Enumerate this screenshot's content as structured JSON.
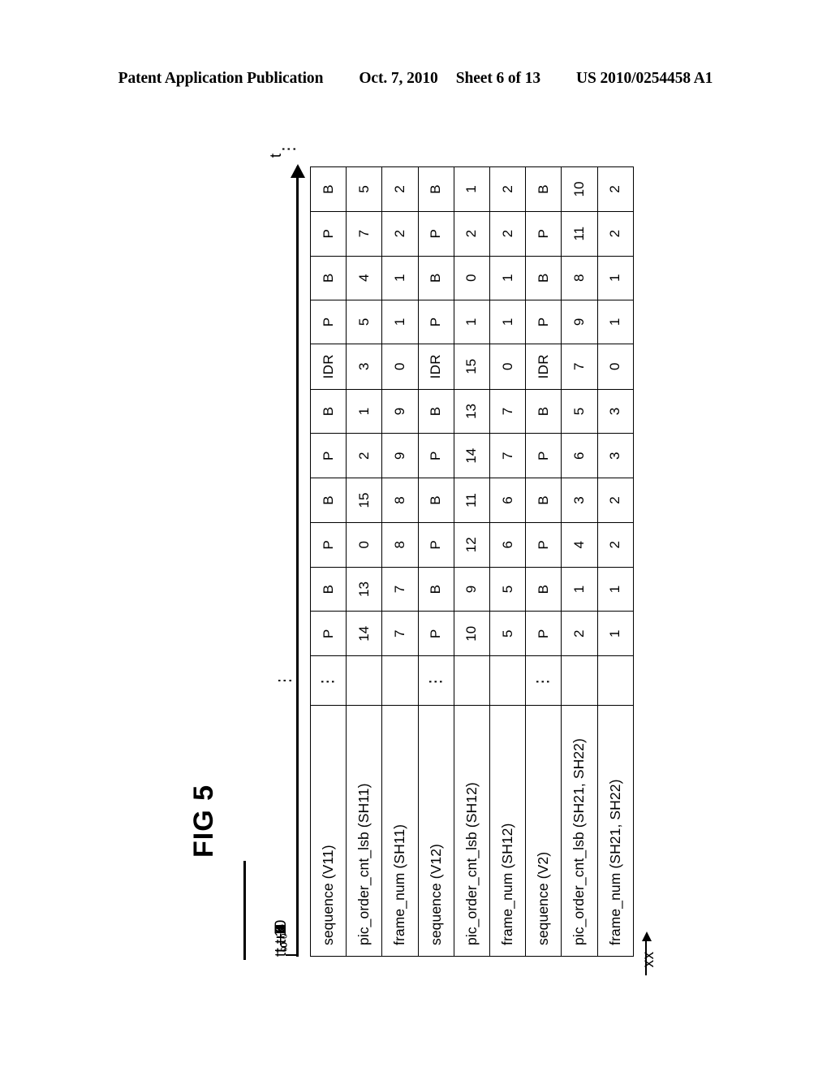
{
  "header": {
    "publication": "Patent Application Publication",
    "date": "Oct. 7, 2010",
    "sheet": "Sheet 6 of 13",
    "patent_number": "US 2010/0254458 A1"
  },
  "figure": {
    "label": "FIG 5",
    "axis_name": "t",
    "axis_trailing_dots": "⋮",
    "leading_dots": "⋮",
    "annotation": "xx",
    "annotation_target_column": "t₀+6",
    "time_labels": [
      "t₀",
      "t₀+1",
      "t₀+2",
      "t₀+3",
      "t₀+4",
      "t₀+5",
      "t₀+6",
      "t₀+7",
      "t₀+8",
      "t₀+9",
      "t₀+10"
    ]
  },
  "chart_data": {
    "type": "table",
    "title": "FIG 5",
    "xlabel": "t",
    "ylabel": "",
    "row_labels": [
      "sequence   (V11)",
      "pic_order_cnt_lsb (SH11)",
      "frame_num (SH11)",
      "sequence   (V12)",
      "pic_order_cnt_lsb (SH12)",
      "frame_num (SH12)",
      "sequence   (V2)",
      "pic_order_cnt_lsb (SH21, SH22)",
      "frame_num (SH21, SH22)"
    ],
    "categories": [
      "t₀",
      "t₀+1",
      "t₀+2",
      "t₀+3",
      "t₀+4",
      "t₀+5",
      "t₀+6",
      "t₀+7",
      "t₀+8",
      "t₀+9",
      "t₀+10"
    ],
    "ellipsis_cells": [
      true,
      false,
      false,
      true,
      false,
      false,
      true,
      false,
      false
    ],
    "rows": [
      {
        "label": "sequence   (V11)",
        "dots": "⋮",
        "values": [
          "P",
          "B",
          "P",
          "B",
          "P",
          "B",
          "IDR",
          "P",
          "B",
          "P",
          "B"
        ]
      },
      {
        "label": "pic_order_cnt_lsb (SH11)",
        "dots": "",
        "values": [
          "14",
          "13",
          "0",
          "15",
          "2",
          "1",
          "3",
          "5",
          "4",
          "7",
          "5"
        ]
      },
      {
        "label": "frame_num (SH11)",
        "dots": "",
        "values": [
          "7",
          "7",
          "8",
          "8",
          "9",
          "9",
          "0",
          "1",
          "1",
          "2",
          "2"
        ]
      },
      {
        "label": "sequence   (V12)",
        "dots": "⋮",
        "values": [
          "P",
          "B",
          "P",
          "B",
          "P",
          "B",
          "IDR",
          "P",
          "B",
          "P",
          "B"
        ]
      },
      {
        "label": "pic_order_cnt_lsb (SH12)",
        "dots": "",
        "values": [
          "10",
          "9",
          "12",
          "11",
          "14",
          "13",
          "15",
          "1",
          "0",
          "2",
          "1"
        ]
      },
      {
        "label": "frame_num (SH12)",
        "dots": "",
        "values": [
          "5",
          "5",
          "6",
          "6",
          "7",
          "7",
          "0",
          "1",
          "1",
          "2",
          "2"
        ]
      },
      {
        "label": "sequence   (V2)",
        "dots": "⋮",
        "values": [
          "P",
          "B",
          "P",
          "B",
          "P",
          "B",
          "IDR",
          "P",
          "B",
          "P",
          "B"
        ]
      },
      {
        "label": "pic_order_cnt_lsb (SH21, SH22)",
        "dots": "",
        "values": [
          "2",
          "1",
          "4",
          "3",
          "6",
          "5",
          "7",
          "9",
          "8",
          "11",
          "10"
        ]
      },
      {
        "label": "frame_num (SH21, SH22)",
        "dots": "",
        "values": [
          "1",
          "1",
          "2",
          "2",
          "3",
          "3",
          "0",
          "1",
          "1",
          "2",
          "2"
        ]
      }
    ]
  }
}
